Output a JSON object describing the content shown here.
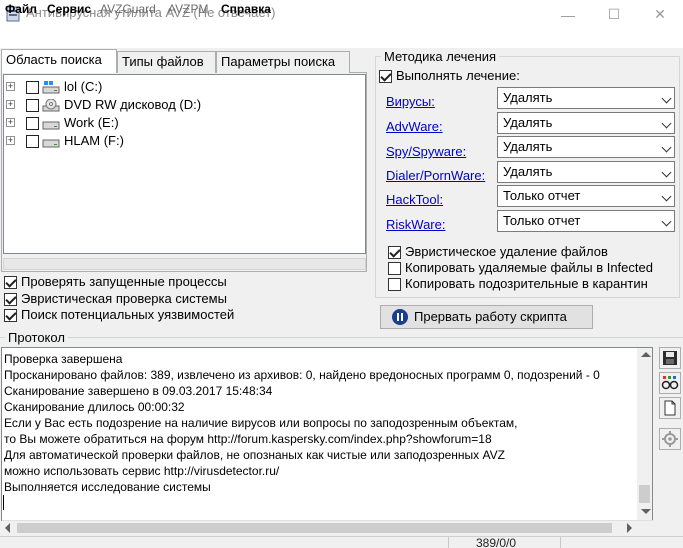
{
  "window": {
    "title": "Антивирусная утилита AVZ (Не отвечает)",
    "controls": {
      "minimize": "—",
      "maximize": "☐",
      "close": "✕"
    }
  },
  "menu": [
    {
      "label": "Файл",
      "enabled": true
    },
    {
      "label": "Сервис",
      "enabled": true
    },
    {
      "label": "AVZGuard",
      "enabled": false
    },
    {
      "label": "AVZPM",
      "enabled": false
    },
    {
      "label": "Справка",
      "enabled": true
    }
  ],
  "tabs": [
    {
      "label": "Область поиска",
      "active": true
    },
    {
      "label": "Типы файлов",
      "active": false
    },
    {
      "label": "Параметры поиска",
      "active": false
    }
  ],
  "drives": [
    {
      "label": "lol (C:)",
      "icon": "system-drive-icon",
      "checked": false
    },
    {
      "label": "DVD RW дисковод (D:)",
      "icon": "dvd-drive-icon",
      "checked": false
    },
    {
      "label": "Work (E:)",
      "icon": "hard-drive-icon",
      "checked": false
    },
    {
      "label": "HLAM (F:)",
      "icon": "hard-drive-icon",
      "checked": false
    }
  ],
  "scan_options": [
    {
      "label": "Проверять запущенные процессы",
      "checked": true
    },
    {
      "label": "Эвристическая проверка системы",
      "checked": true
    },
    {
      "label": "Поиск потенциальных уязвимостей",
      "checked": true
    }
  ],
  "treatment": {
    "group_title": "Методика лечения",
    "perform_label": "Выполнять лечение:",
    "perform_checked": true,
    "rows": [
      {
        "link": "Вирусы:",
        "value": "Удалять"
      },
      {
        "link": "AdvWare:",
        "value": "Удалять"
      },
      {
        "link": "Spy/Spyware:",
        "value": "Удалять"
      },
      {
        "link": "Dialer/PornWare:",
        "value": "Удалять"
      },
      {
        "link": "HackTool:",
        "value": "Только отчет"
      },
      {
        "link": "RiskWare:",
        "value": "Только отчет"
      }
    ],
    "options": [
      {
        "label": "Эвристическое удаление файлов",
        "checked": true
      },
      {
        "label": "Копировать удаляемые файлы в  Infected",
        "checked": false
      },
      {
        "label": "Копировать подозрительные в  карантин",
        "checked": false
      }
    ]
  },
  "stop_button": {
    "label": "Прервать работу скрипта"
  },
  "protocol": {
    "title": "Протокол",
    "lines": [
      "Проверка завершена",
      "Просканировано файлов: 389, извлечено из архивов: 0, найдено вредоносных программ 0, подозрений - 0",
      "Сканирование завершено в 09.03.2017 15:48:34",
      "Сканирование длилось 00:00:32",
      "Если у Вас есть подозрение на наличие вирусов или вопросы по заподозренным объектам,",
      "то Вы можете обратиться на форум http://forum.kaspersky.com/index.php?showforum=18",
      "Для автоматической проверки файлов, не опознаных как чистые или заподозренных AVZ",
      "можно использовать сервис http://virusdetector.ru/",
      "Выполняется исследование системы"
    ]
  },
  "side_buttons": [
    {
      "icon": "save-icon"
    },
    {
      "icon": "glasses-icon"
    },
    {
      "icon": "new-document-icon"
    },
    {
      "icon": "settings-icon"
    }
  ],
  "status": {
    "counter": "389/0/0"
  },
  "colors": {
    "link": "#0000cc",
    "window_bg": "#f0f0f0",
    "stop_icon": "#1a3d8f"
  }
}
